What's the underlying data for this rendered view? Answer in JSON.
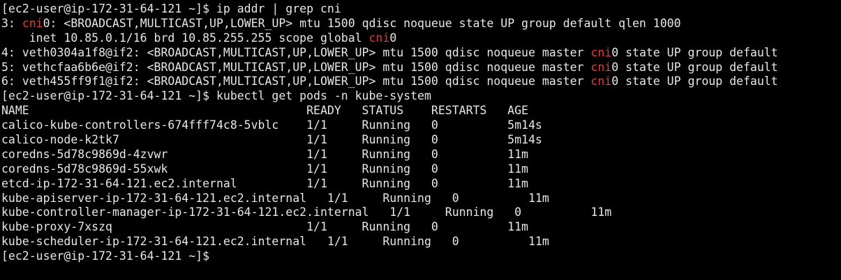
{
  "colors": {
    "background": "#000000",
    "text": "#e8e8e8",
    "grep_match": "#e23b3b"
  },
  "terminal": {
    "lines": [
      {
        "id": "prompt-1",
        "parts": [
          {
            "t": "[ec2-user@ip-172-31-64-121 ~]$ ip addr | grep cni"
          }
        ]
      },
      {
        "id": "ipaddr-1",
        "parts": [
          {
            "t": "3: "
          },
          {
            "t": "cni",
            "hl": true
          },
          {
            "t": "0: <BROADCAST,MULTICAST,UP,LOWER_UP> mtu 1500 qdisc noqueue state UP group default qlen 1000"
          }
        ]
      },
      {
        "id": "ipaddr-2",
        "parts": [
          {
            "t": "    inet 10.85.0.1/16 brd 10.85.255.255 scope global "
          },
          {
            "t": "cni",
            "hl": true
          },
          {
            "t": "0"
          }
        ]
      },
      {
        "id": "ipaddr-3",
        "parts": [
          {
            "t": "4: veth0304a1f8@if2: <BROADCAST,MULTICAST,UP,LOWER_UP> mtu 1500 qdisc noqueue master "
          },
          {
            "t": "cni",
            "hl": true
          },
          {
            "t": "0 state UP group default"
          }
        ]
      },
      {
        "id": "ipaddr-4",
        "parts": [
          {
            "t": "5: vethcfaa6b6e@if2: <BROADCAST,MULTICAST,UP,LOWER_UP> mtu 1500 qdisc noqueue master "
          },
          {
            "t": "cni",
            "hl": true
          },
          {
            "t": "0 state UP group default"
          }
        ]
      },
      {
        "id": "ipaddr-5",
        "parts": [
          {
            "t": "6: veth455ff9f1@if2: <BROADCAST,MULTICAST,UP,LOWER_UP> mtu 1500 qdisc noqueue master "
          },
          {
            "t": "cni",
            "hl": true
          },
          {
            "t": "0 state UP group default"
          }
        ]
      },
      {
        "id": "prompt-2",
        "parts": [
          {
            "t": "[ec2-user@ip-172-31-64-121 ~]$ kubectl get pods -n kube-system"
          }
        ]
      },
      {
        "id": "pods-header",
        "parts": [
          {
            "t": "NAME                                        READY   STATUS    RESTARTS   AGE"
          }
        ]
      },
      {
        "id": "pod-row",
        "parts": [
          {
            "t": "calico-kube-controllers-674fff74c8-5vblc    1/1     Running   0          5m14s"
          }
        ]
      },
      {
        "id": "pod-row",
        "parts": [
          {
            "t": "calico-node-k2tk7                           1/1     Running   0          5m14s"
          }
        ]
      },
      {
        "id": "pod-row",
        "parts": [
          {
            "t": "coredns-5d78c9869d-4zvwr                    1/1     Running   0          11m"
          }
        ]
      },
      {
        "id": "pod-row",
        "parts": [
          {
            "t": "coredns-5d78c9869d-55xwk                    1/1     Running   0          11m"
          }
        ]
      },
      {
        "id": "pod-row",
        "parts": [
          {
            "t": "etcd-ip-172-31-64-121.ec2.internal          1/1     Running   0          11m"
          }
        ]
      },
      {
        "id": "pod-row",
        "parts": [
          {
            "t": "kube-apiserver-ip-172-31-64-121.ec2.internal   1/1     Running   0          11m"
          }
        ]
      },
      {
        "id": "pod-row",
        "parts": [
          {
            "t": "kube-controller-manager-ip-172-31-64-121.ec2.internal   1/1     Running   0          11m"
          }
        ]
      },
      {
        "id": "pod-row",
        "parts": [
          {
            "t": "kube-proxy-7xszq                            1/1     Running   0          11m"
          }
        ]
      },
      {
        "id": "pod-row",
        "parts": [
          {
            "t": "kube-scheduler-ip-172-31-64-121.ec2.internal   1/1     Running   0          11m"
          }
        ]
      },
      {
        "id": "prompt-3",
        "parts": [
          {
            "t": "[ec2-user@ip-172-31-64-121 ~]$"
          }
        ]
      }
    ]
  }
}
